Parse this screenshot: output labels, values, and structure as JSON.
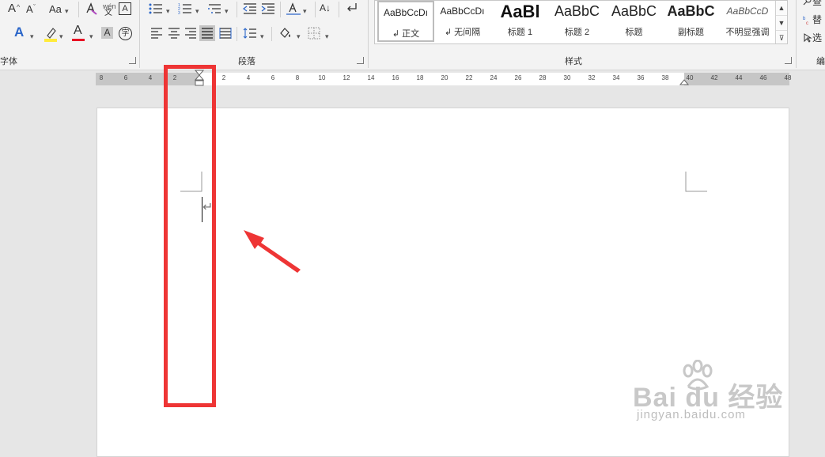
{
  "colors": {
    "annotation_red": "#ee3535",
    "highlight_yellow": "#ffeb3b",
    "font_red": "#e81123",
    "ribbon_bg": "#f3f3f3",
    "canvas_bg": "#e6e6e6"
  },
  "ribbon": {
    "font_group": {
      "label": "字体",
      "grow_font": "A",
      "shrink_font": "A",
      "change_case": "Aa",
      "phonetic_top": "wén",
      "phonetic_bottom": "文",
      "char_border": "A",
      "text_effect": "A",
      "font_color": "A",
      "char_shading": "A",
      "enclose_char": "字",
      "highlight_icon": "highlighter-icon",
      "clear_format_icon": "clear-format-icon"
    },
    "paragraph_group": {
      "label": "段落",
      "sort": "A↓"
    },
    "styles_group": {
      "label": "样式",
      "items": [
        {
          "sample": "AaBbCcDı",
          "name": "↲ 正文"
        },
        {
          "sample": "AaBbCcDı",
          "name": "↲ 无间隔"
        },
        {
          "sample": "AaBl",
          "name": "标题 1"
        },
        {
          "sample": "AaBbC",
          "name": "标题 2"
        },
        {
          "sample": "AaBbC",
          "name": "标题"
        },
        {
          "sample": "AaBbC",
          "name": "副标题"
        },
        {
          "sample": "AaBbCcD",
          "name": "不明显强调"
        }
      ],
      "scroll_up": "▲",
      "scroll_down": "▼",
      "more": "⊽"
    },
    "editing_group": {
      "find_partial": "查",
      "replace_partial": "替",
      "select_partial": "选",
      "label_partial": "编"
    }
  },
  "ruler": {
    "ticks": [
      "8",
      "6",
      "4",
      "2",
      "2",
      "4",
      "6",
      "8",
      "10",
      "12",
      "14",
      "16",
      "18",
      "20",
      "22",
      "24",
      "26",
      "28",
      "30",
      "32",
      "34",
      "36",
      "38",
      "40",
      "42",
      "44",
      "46",
      "48"
    ]
  },
  "document": {
    "paragraph_mark": "↵"
  },
  "watermark": {
    "brand": "Bai du 经验",
    "url": "jingyan.baidu.com"
  }
}
